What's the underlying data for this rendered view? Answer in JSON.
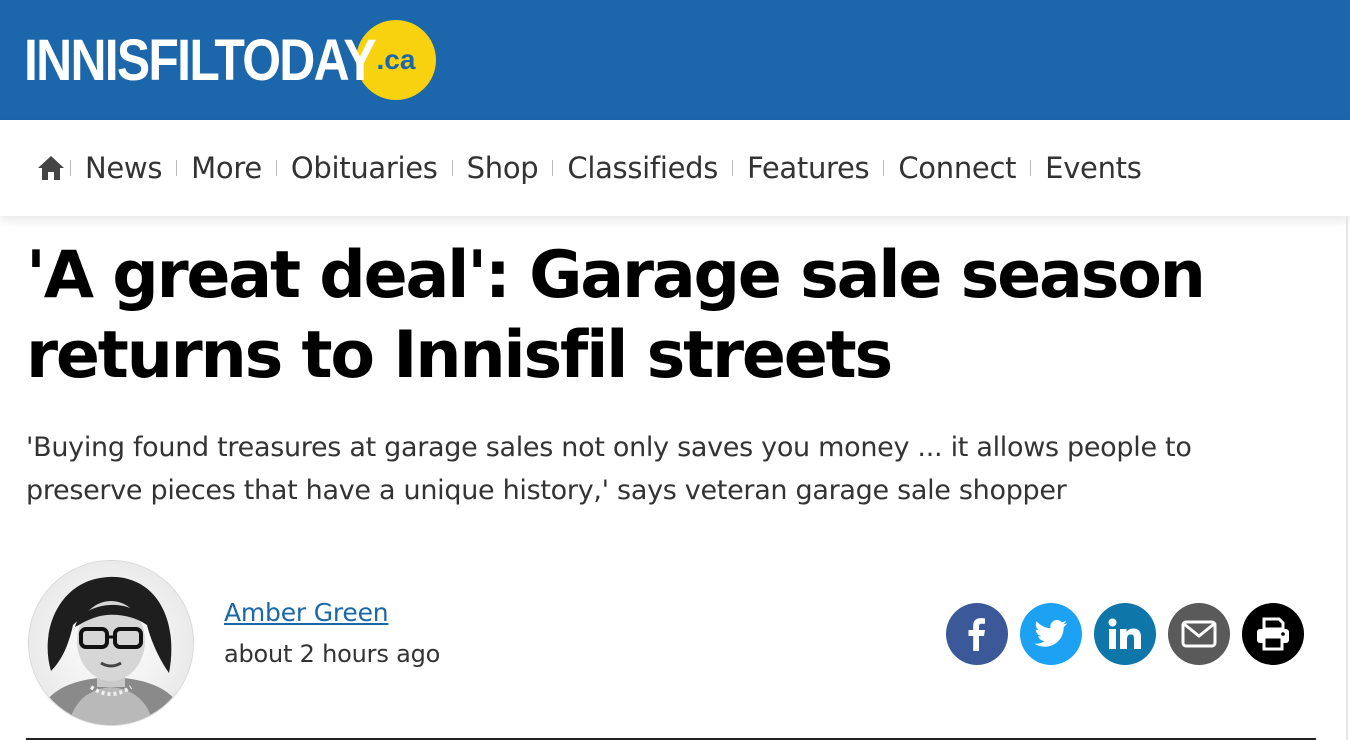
{
  "site": {
    "logo_text": "INNISFILTODAY",
    "logo_badge": ".ca",
    "colors": {
      "brand_blue": "#1c67ab",
      "badge_yellow": "#f9d20f"
    }
  },
  "nav": {
    "home_icon": "home-icon",
    "items": [
      "News",
      "More",
      "Obituaries",
      "Shop",
      "Classifieds",
      "Features",
      "Connect",
      "Events"
    ]
  },
  "article": {
    "headline": "'A great deal': Garage sale season returns to Innisfil streets",
    "subheadline": "'Buying found treasures at garage sales not only saves you money ... it allows people to preserve pieces that have a unique history,' says veteran garage sale shopper",
    "author": "Amber Green",
    "timestamp": "about 2 hours ago"
  },
  "share": {
    "buttons": [
      {
        "name": "facebook-icon",
        "color": "#3b5998"
      },
      {
        "name": "twitter-icon",
        "color": "#1da1f2"
      },
      {
        "name": "linkedin-icon",
        "color": "#0e76a8"
      },
      {
        "name": "email-icon",
        "color": "#5a5a5a"
      },
      {
        "name": "print-icon",
        "color": "#000000"
      }
    ]
  }
}
